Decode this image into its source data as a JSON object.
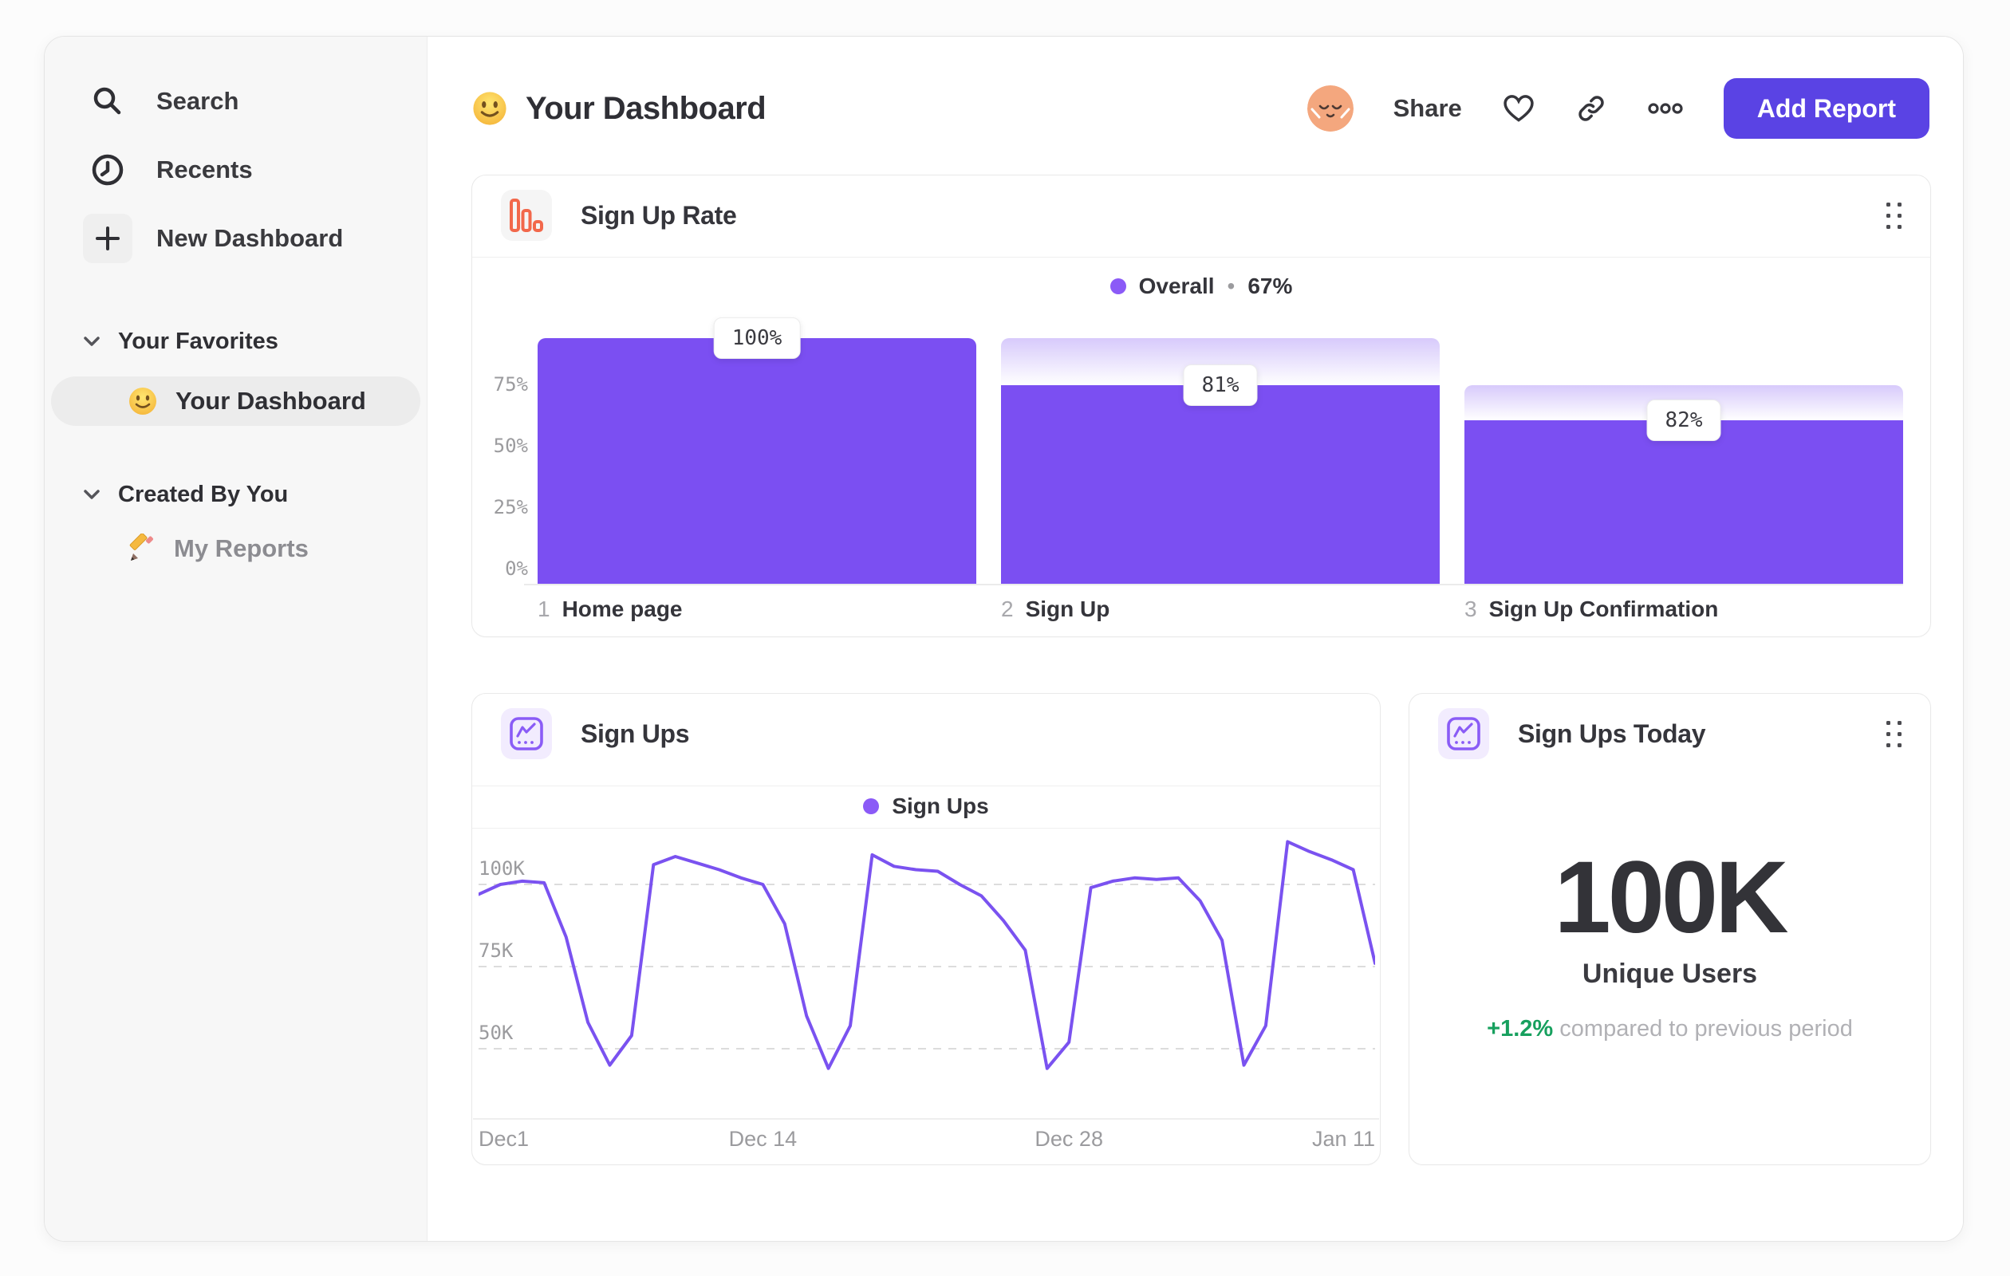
{
  "sidebar": {
    "nav": [
      {
        "label": "Search"
      },
      {
        "label": "Recents"
      },
      {
        "label": "New Dashboard"
      }
    ],
    "sections": [
      {
        "title": "Your Favorites",
        "items": [
          {
            "label": "Your Dashboard",
            "selected": true
          }
        ]
      },
      {
        "title": "Created By You",
        "items": [
          {
            "label": "My Reports",
            "selected": false
          }
        ]
      }
    ]
  },
  "header": {
    "title": "Your Dashboard",
    "share": "Share",
    "add_report": "Add Report"
  },
  "colors": {
    "bar_purple": "#7B4FF2",
    "line_purple": "#7A52F0",
    "legend_dot": "#8B5AF7",
    "button_purple": "#5A43E4",
    "funnel_icon_orange": "#F2684B",
    "chart_icon_purple": "#8A5CF6",
    "delta_green": "#17A05E"
  },
  "chart_data": [
    {
      "id": "signup-rate",
      "type": "bar",
      "title": "Sign Up Rate",
      "legend": {
        "name": "Overall",
        "separator": "•",
        "value": "67%"
      },
      "ylim": [
        0,
        100
      ],
      "yticks": [
        {
          "label": "75%",
          "value": 75
        },
        {
          "label": "50%",
          "value": 50
        },
        {
          "label": "25%",
          "value": 25
        },
        {
          "label": "0%",
          "value": 0
        }
      ],
      "steps": [
        {
          "num": "1",
          "label": "Home page",
          "conversion_pct": 100,
          "value_label": "100%"
        },
        {
          "num": "2",
          "label": "Sign Up",
          "conversion_pct": 81,
          "value_label": "81%"
        },
        {
          "num": "3",
          "label": "Sign Up Confirmation",
          "conversion_pct": 82,
          "value_label": "82%"
        }
      ],
      "grid": false,
      "legend_position": "top-center"
    },
    {
      "id": "signups-trend",
      "type": "line",
      "title": "Sign Ups",
      "legend": "Sign Ups",
      "unit": "K",
      "ylim": [
        29,
        117
      ],
      "yticks": [
        {
          "label": "100K",
          "value": 100
        },
        {
          "label": "75K",
          "value": 75
        },
        {
          "label": "50K",
          "value": 50
        }
      ],
      "x_tick_labels": [
        "Dec1",
        "Dec 14",
        "Dec 28",
        "Jan 11"
      ],
      "x_tick_positions": [
        0,
        13,
        27,
        41
      ],
      "values": [
        97,
        100,
        101,
        100.5,
        84,
        58,
        45,
        54,
        106,
        108.5,
        106.5,
        104.5,
        102,
        100,
        88,
        60,
        44,
        57,
        109,
        105.5,
        104.5,
        104,
        100,
        96.5,
        89,
        80,
        44,
        52,
        99,
        101,
        102,
        101.5,
        102,
        95,
        83,
        45,
        57,
        113,
        110,
        107.5,
        104.5,
        76
      ],
      "grid": "dashed-horizontal",
      "legend_position": "top-center"
    },
    {
      "id": "signups-today",
      "type": "metric",
      "title": "Sign Ups Today",
      "value": "100K",
      "label": "Unique Users",
      "delta": "+1.2%",
      "delta_suffix": "compared to previous period"
    }
  ]
}
